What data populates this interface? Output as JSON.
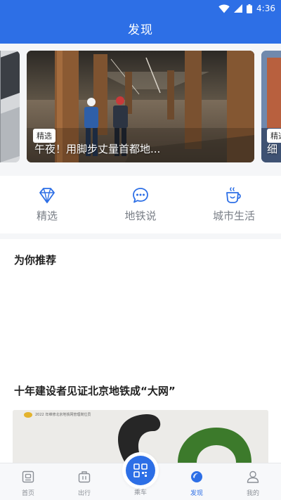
{
  "status_bar": {
    "time": "4:36",
    "icons": [
      "wifi-icon",
      "signal-icon",
      "battery-icon"
    ]
  },
  "header": {
    "title": "发现"
  },
  "carousel": {
    "cards": [
      {
        "tag": "",
        "caption": ""
      },
      {
        "tag": "精选",
        "caption": "午夜！用脚步丈量首都地..."
      },
      {
        "tag": "精选",
        "caption": "细"
      }
    ]
  },
  "categories": [
    {
      "label": "精选",
      "icon": "diamond-icon"
    },
    {
      "label": "地铁说",
      "icon": "chat-bubble-icon"
    },
    {
      "label": "城市生活",
      "icon": "coffee-cup-icon"
    }
  ],
  "recommend": {
    "title": "为你推荐",
    "article": {
      "title": "十年建设者见证北京地铁成“大网”",
      "thumb_caption": "2022 年维修北京地铁网管理岗位员"
    }
  },
  "tabbar": {
    "tabs": [
      {
        "label": "首页",
        "icon": "home-icon"
      },
      {
        "label": "出行",
        "icon": "bag-icon"
      },
      {
        "label": "乘车",
        "icon": "qr-code-icon"
      },
      {
        "label": "发现",
        "icon": "discover-icon"
      },
      {
        "label": "我的",
        "icon": "person-icon"
      }
    ],
    "active": "发现"
  },
  "colors": {
    "primary": "#2d6fe6",
    "background": "#f5f6f8",
    "muted_text": "#7a7f87"
  }
}
